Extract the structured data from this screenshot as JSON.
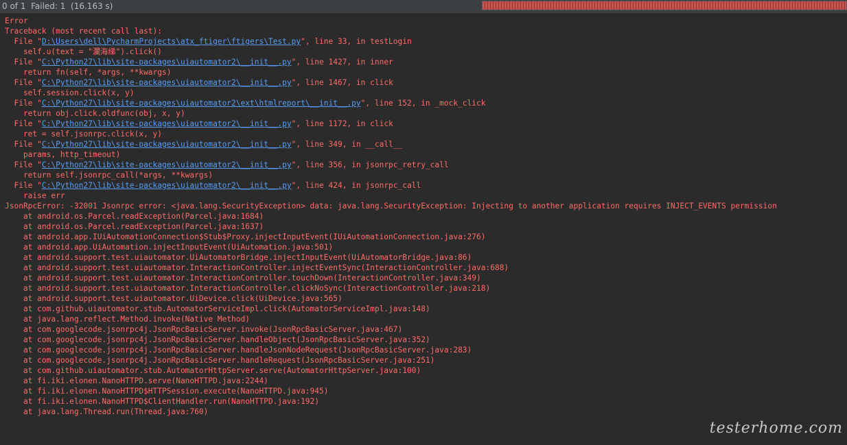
{
  "status": {
    "summary": "0 of 1  Failed: 1  (16.163 s)",
    "progress_fraction": 1.0,
    "progress_color": "#c75450"
  },
  "console": {
    "lines": [
      {
        "type": "error",
        "text": "Error"
      },
      {
        "type": "error",
        "text": "Traceback (most recent call last):"
      },
      {
        "type": "frame",
        "prefix": "  File \"",
        "path": "D:\\Users\\dell\\PycharmProjects\\atx_ftiger\\ftigers\\Test.py",
        "suffix": "\", line 33, in testLogin"
      },
      {
        "type": "error",
        "text": "    self.u(text = \"瀾海绨\").click()"
      },
      {
        "type": "frame",
        "prefix": "  File \"",
        "path": "C:\\Python27\\lib\\site-packages\\uiautomator2\\__init__.py",
        "suffix": "\", line 1427, in inner"
      },
      {
        "type": "error",
        "text": "    return fn(self, *args, **kwargs)"
      },
      {
        "type": "frame",
        "prefix": "  File \"",
        "path": "C:\\Python27\\lib\\site-packages\\uiautomator2\\__init__.py",
        "suffix": "\", line 1467, in click"
      },
      {
        "type": "error",
        "text": "    self.session.click(x, y)"
      },
      {
        "type": "frame",
        "prefix": "  File \"",
        "path": "C:\\Python27\\lib\\site-packages\\uiautomator2\\ext\\htmlreport\\__init__.py",
        "suffix": "\", line 152, in _mock_click"
      },
      {
        "type": "error",
        "text": "    return obj.click.oldfunc(obj, x, y)"
      },
      {
        "type": "frame",
        "prefix": "  File \"",
        "path": "C:\\Python27\\lib\\site-packages\\uiautomator2\\__init__.py",
        "suffix": "\", line 1172, in click"
      },
      {
        "type": "error",
        "text": "    ret = self.jsonrpc.click(x, y)"
      },
      {
        "type": "frame",
        "prefix": "  File \"",
        "path": "C:\\Python27\\lib\\site-packages\\uiautomator2\\__init__.py",
        "suffix": "\", line 349, in __call__"
      },
      {
        "type": "error",
        "text": "    params, http_timeout)"
      },
      {
        "type": "frame",
        "prefix": "  File \"",
        "path": "C:\\Python27\\lib\\site-packages\\uiautomator2\\__init__.py",
        "suffix": "\", line 356, in jsonrpc_retry_call"
      },
      {
        "type": "error",
        "text": "    return self.jsonrpc_call(*args, **kwargs)"
      },
      {
        "type": "frame",
        "prefix": "  File \"",
        "path": "C:\\Python27\\lib\\site-packages\\uiautomator2\\__init__.py",
        "suffix": "\", line 424, in jsonrpc_call"
      },
      {
        "type": "error",
        "text": "    raise err"
      },
      {
        "type": "error",
        "text": "JsonRpcError: -32001 Jsonrpc error: <java.lang.SecurityException> data: java.lang.SecurityException: Injecting to another application requires INJECT_EVENTS permission"
      },
      {
        "type": "error",
        "text": "    at android.os.Parcel.readException(Parcel.java:1684)"
      },
      {
        "type": "error",
        "text": "    at android.os.Parcel.readException(Parcel.java:1637)"
      },
      {
        "type": "error",
        "text": "    at android.app.IUiAutomationConnection$Stub$Proxy.injectInputEvent(IUiAutomationConnection.java:276)"
      },
      {
        "type": "error",
        "text": "    at android.app.UiAutomation.injectInputEvent(UiAutomation.java:501)"
      },
      {
        "type": "error",
        "text": "    at android.support.test.uiautomator.UiAutomatorBridge.injectInputEvent(UiAutomatorBridge.java:86)"
      },
      {
        "type": "error",
        "text": "    at android.support.test.uiautomator.InteractionController.injectEventSync(InteractionController.java:688)"
      },
      {
        "type": "error",
        "text": "    at android.support.test.uiautomator.InteractionController.touchDown(InteractionController.java:349)"
      },
      {
        "type": "error",
        "text": "    at android.support.test.uiautomator.InteractionController.clickNoSync(InteractionController.java:218)"
      },
      {
        "type": "error",
        "text": "    at android.support.test.uiautomator.UiDevice.click(UiDevice.java:565)"
      },
      {
        "type": "error",
        "text": "    at com.github.uiautomator.stub.AutomatorServiceImpl.click(AutomatorServiceImpl.java:148)"
      },
      {
        "type": "error",
        "text": "    at java.lang.reflect.Method.invoke(Native Method)"
      },
      {
        "type": "error",
        "text": "    at com.googlecode.jsonrpc4j.JsonRpcBasicServer.invoke(JsonRpcBasicServer.java:467)"
      },
      {
        "type": "error",
        "text": "    at com.googlecode.jsonrpc4j.JsonRpcBasicServer.handleObject(JsonRpcBasicServer.java:352)"
      },
      {
        "type": "error",
        "text": "    at com.googlecode.jsonrpc4j.JsonRpcBasicServer.handleJsonNodeRequest(JsonRpcBasicServer.java:283)"
      },
      {
        "type": "error",
        "text": "    at com.googlecode.jsonrpc4j.JsonRpcBasicServer.handleRequest(JsonRpcBasicServer.java:251)"
      },
      {
        "type": "error",
        "text": "    at com.github.uiautomator.stub.AutomatorHttpServer.serve(AutomatorHttpServer.java:100)"
      },
      {
        "type": "error",
        "text": "    at fi.iki.elonen.NanoHTTPD.serve(NanoHTTPD.java:2244)"
      },
      {
        "type": "error",
        "text": "    at fi.iki.elonen.NanoHTTPD$HTTPSession.execute(NanoHTTPD.java:945)"
      },
      {
        "type": "error",
        "text": "    at fi.iki.elonen.NanoHTTPD$ClientHandler.run(NanoHTTPD.java:192)"
      },
      {
        "type": "error",
        "text": "    at java.lang.Thread.run(Thread.java:760)"
      }
    ]
  },
  "watermark": "testerhome.com",
  "colors": {
    "background": "#2b2b2b",
    "error_text": "#ff6b68",
    "link": "#589df6",
    "status_text": "#bbbbbb"
  }
}
